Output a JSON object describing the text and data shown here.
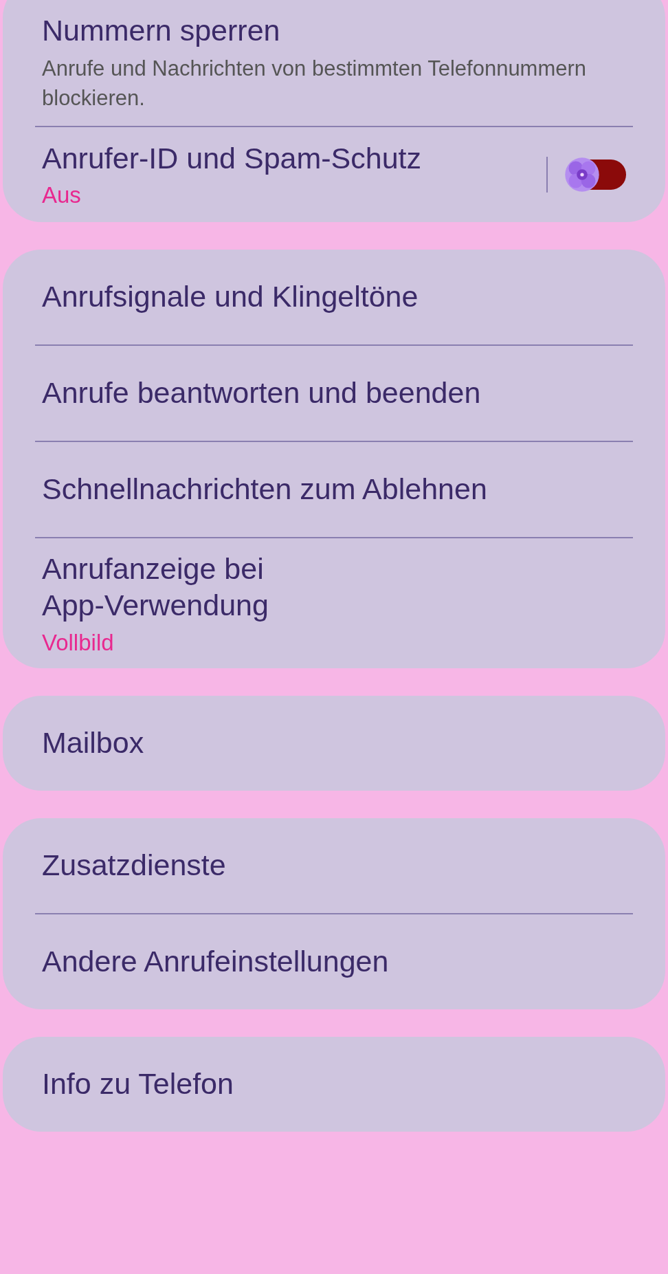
{
  "sections": [
    {
      "items": [
        {
          "kind": "text",
          "title": "Nummern sperren",
          "description": "Anrufe und Nachrichten von bestimmten Telefonnummern blockieren."
        },
        {
          "kind": "toggle",
          "title": "Anrufer-ID und Spam-Schutz",
          "status": "Aus",
          "on": false
        }
      ]
    },
    {
      "items": [
        {
          "kind": "text",
          "title": "Anrufsignale und Klingeltöne"
        },
        {
          "kind": "text",
          "title": "Anrufe beantworten und beenden"
        },
        {
          "kind": "text",
          "title": "Schnellnachrichten zum Ablehnen"
        },
        {
          "kind": "text",
          "title": "Anrufanzeige bei\nApp-Verwendung",
          "status": "Vollbild"
        }
      ]
    },
    {
      "items": [
        {
          "kind": "text",
          "title": "Mailbox"
        }
      ]
    },
    {
      "items": [
        {
          "kind": "text",
          "title": "Zusatzdienste"
        },
        {
          "kind": "text",
          "title": "Andere Anrufeinstellungen"
        }
      ]
    },
    {
      "items": [
        {
          "kind": "text",
          "title": "Info zu Telefon"
        }
      ]
    }
  ]
}
